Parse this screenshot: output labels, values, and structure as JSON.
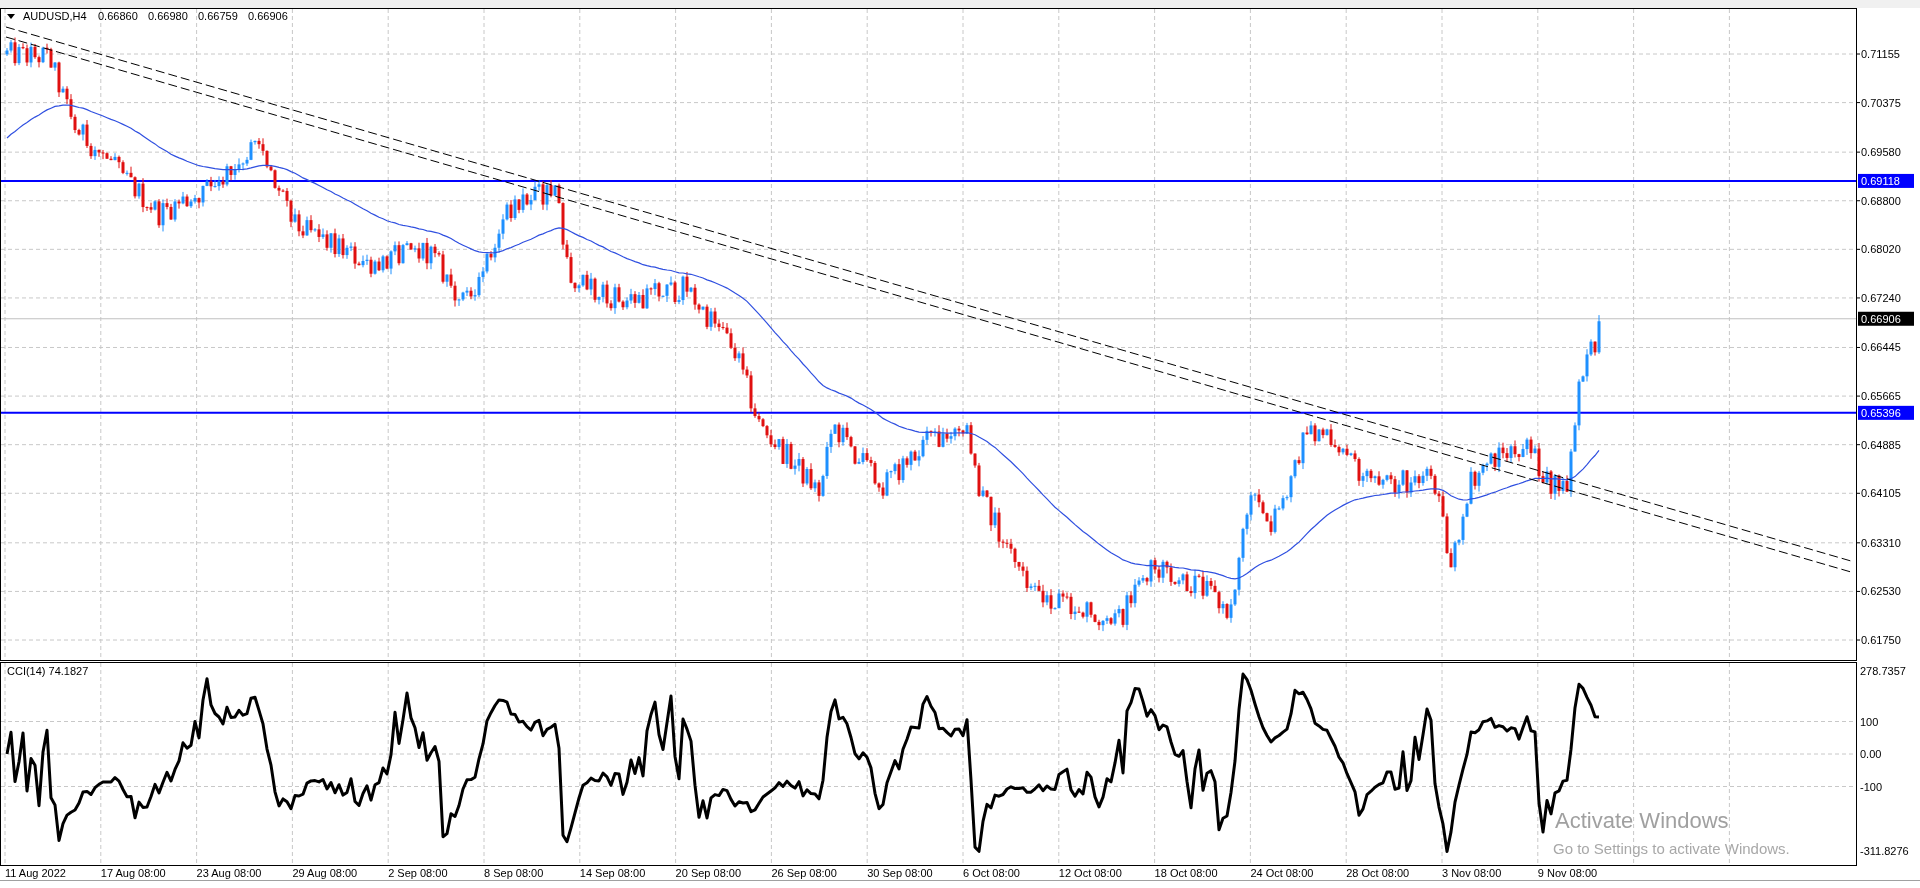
{
  "chart": {
    "symbol": "AUDUSD,H4",
    "quotes": [
      "0.66860",
      "0.66980",
      "0.66759",
      "0.66906"
    ]
  },
  "price_axis": {
    "ticks": [
      "0.71155",
      "0.70375",
      "0.69580",
      "0.68800",
      "0.68020",
      "0.67240",
      "0.66445",
      "0.65665",
      "0.64885",
      "0.64105",
      "0.63310",
      "0.62530",
      "0.61750"
    ],
    "markers": [
      {
        "label": "0.69118",
        "kind": "level"
      },
      {
        "label": "0.66906",
        "kind": "bid"
      },
      {
        "label": "0.65396",
        "kind": "level"
      }
    ]
  },
  "cci_panel": {
    "title": "CCI(14) 74.1827",
    "ticks": [
      "278.7357",
      "100",
      "0.00",
      "-100",
      "-311.8276"
    ]
  },
  "date_axis": [
    "11 Aug 2022",
    "17 Aug 08:00",
    "23 Aug 08:00",
    "29 Aug 08:00",
    "2 Sep 08:00",
    "8 Sep 08:00",
    "14 Sep 08:00",
    "20 Sep 08:00",
    "26 Sep 08:00",
    "30 Sep 08:00",
    "6 Oct 08:00",
    "12 Oct 08:00",
    "18 Oct 08:00",
    "24 Oct 08:00",
    "28 Oct 08:00",
    "3 Nov 08:00",
    "9 Nov 08:00"
  ],
  "os_notice": {
    "title": "Activate Windows",
    "message": "Go to Settings to activate Windows."
  }
}
